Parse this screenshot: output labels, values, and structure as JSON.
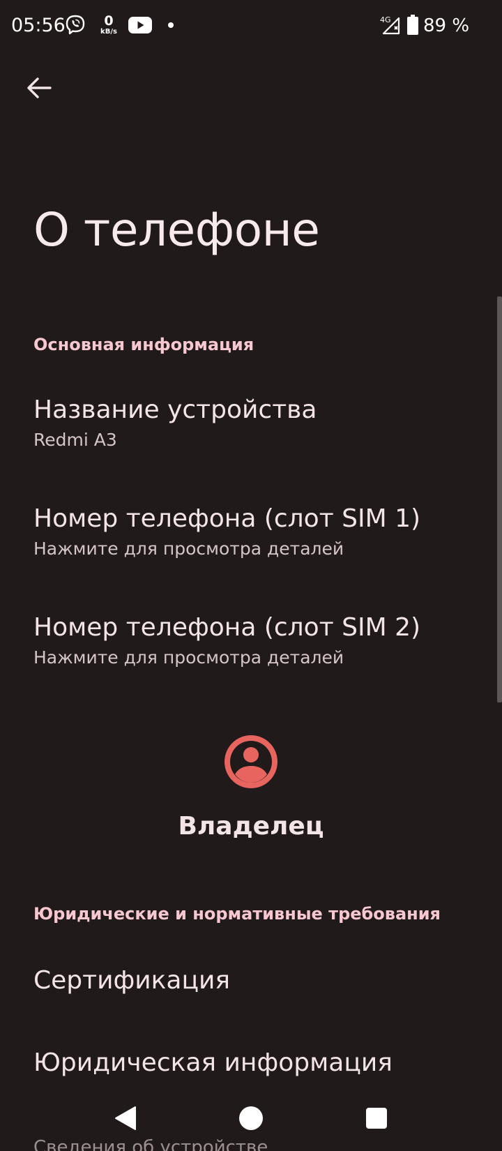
{
  "status_bar": {
    "time": "05:56",
    "net_speed_value": "0",
    "net_speed_unit": "kB/s",
    "network_type": "4G",
    "battery": "89 %",
    "icons": [
      "viber-icon",
      "youtube-icon",
      "notification-dot-icon",
      "signal-icon",
      "battery-icon"
    ]
  },
  "header": {
    "back_icon": "arrow-left-icon",
    "title": "О телефоне"
  },
  "sections": {
    "basic_info": {
      "header": "Основная информация",
      "device_name": {
        "title": "Название устройства",
        "summary": "Redmi A3"
      },
      "phone_sim1": {
        "title": "Номер телефона (слот SIM 1)",
        "summary": "Нажмите для просмотра деталей"
      },
      "phone_sim2": {
        "title": "Номер телефона (слот SIM 2)",
        "summary": "Нажмите для просмотра деталей"
      }
    },
    "owner": {
      "icon": "account-circle-icon",
      "label": "Владелец"
    },
    "legal": {
      "header": "Юридические и нормативные требования",
      "certification": {
        "title": "Сертификация"
      },
      "legal_info": {
        "title": "Юридическая информация"
      },
      "device_details_peek": "Сведения об устройстве"
    }
  },
  "colors": {
    "background": "#211a1b",
    "section_header": "#f7c8cf",
    "accent_avatar": "#e8655f",
    "text_primary": "#f3e4e6",
    "text_secondary": "#d5c5c7"
  },
  "nav_bar": {
    "icons": [
      "back-triangle-icon",
      "home-circle-icon",
      "recents-square-icon"
    ]
  }
}
